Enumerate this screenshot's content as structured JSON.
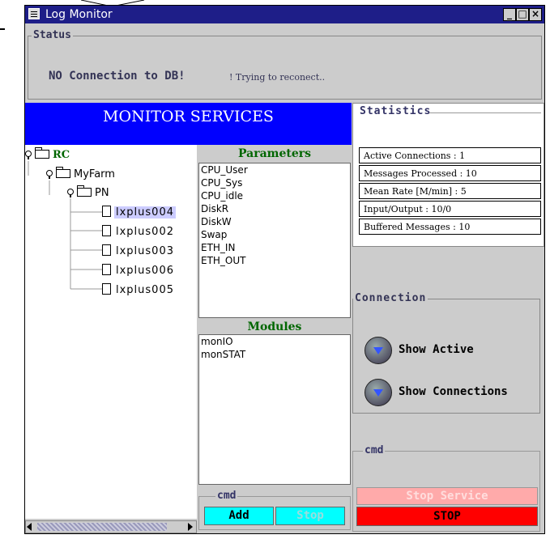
{
  "window": {
    "title": "Log Monitor"
  },
  "status": {
    "label": "Status",
    "error": "NO Connection to DB!",
    "retry": "! Trying to reconect.."
  },
  "banner": "MONITOR SERVICES",
  "tree": {
    "root": "RC",
    "farm": "MyFarm",
    "group": "PN",
    "hosts": [
      "lxplus004",
      "lxplus002",
      "lxplus003",
      "lxplus006",
      "lxplus005"
    ]
  },
  "parameters": {
    "header": "Parameters",
    "items": [
      "CPU_User",
      "CPU_Sys",
      "CPU_idle",
      "DiskR",
      "DiskW",
      "Swap",
      "ETH_IN",
      "ETH_OUT"
    ]
  },
  "modules": {
    "header": "Modules",
    "items": [
      "monIO",
      "monSTAT"
    ]
  },
  "cmd_left": {
    "label": "cmd",
    "add": "Add",
    "stop": "Stop"
  },
  "statistics": {
    "label": "Statistics",
    "rows": [
      "Active Connections : 1",
      "Messages Processed : 10",
      "Mean Rate [M/min]  : 5",
      "Input/Output   : 10/0",
      "Buffered Messages     : 10"
    ]
  },
  "connection": {
    "label": "Connection",
    "show_active": "Show Active",
    "show_connections": "Show Connections"
  },
  "cmd_right": {
    "label": "cmd",
    "stop_service": "Stop Service",
    "stop": "STOP"
  },
  "colors": {
    "titlebar": "#1e1e88",
    "banner": "#0000ff",
    "add": "#00ffff",
    "stop_red": "#ff0000",
    "stop_service": "#ffaaaa"
  }
}
